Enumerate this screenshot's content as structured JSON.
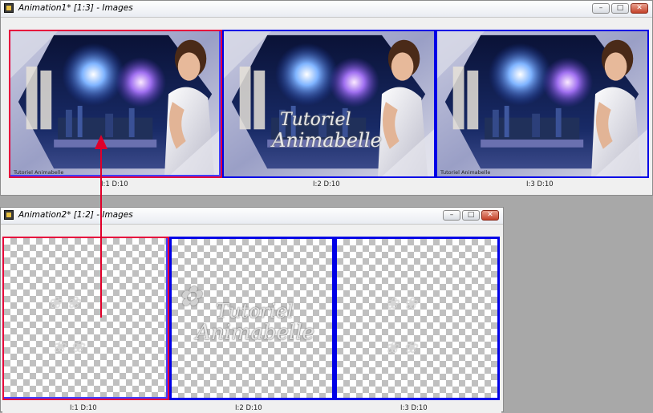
{
  "window1": {
    "title": "Animation1* [1:3] - Images",
    "controls": {
      "minimize": "–",
      "restore": "□",
      "close": "✕"
    },
    "frames": [
      {
        "label": "I:1  D:10",
        "signature": "Tutoriel Animabelle"
      },
      {
        "label": "I:2  D:10",
        "watermark_line1": "Tutoriel",
        "watermark_line2": "Animabelle"
      },
      {
        "label": "I:3  D:10",
        "signature": "Tutoriel Animabelle"
      }
    ]
  },
  "window2": {
    "title": "Animation2* [1:2] - Images",
    "controls": {
      "minimize": "–",
      "restore": "□",
      "close": "✕"
    },
    "frames": [
      {
        "label": "I:1  D:10"
      },
      {
        "label": "I:2  D:10",
        "watermark_line1": "Tutoriel",
        "watermark_line2": "Animabelle"
      },
      {
        "label": "I:3  D:10"
      }
    ]
  },
  "colors": {
    "frame_border": "#0000e6",
    "selected_border": "#e6003c",
    "arrow": "#e0002a"
  }
}
